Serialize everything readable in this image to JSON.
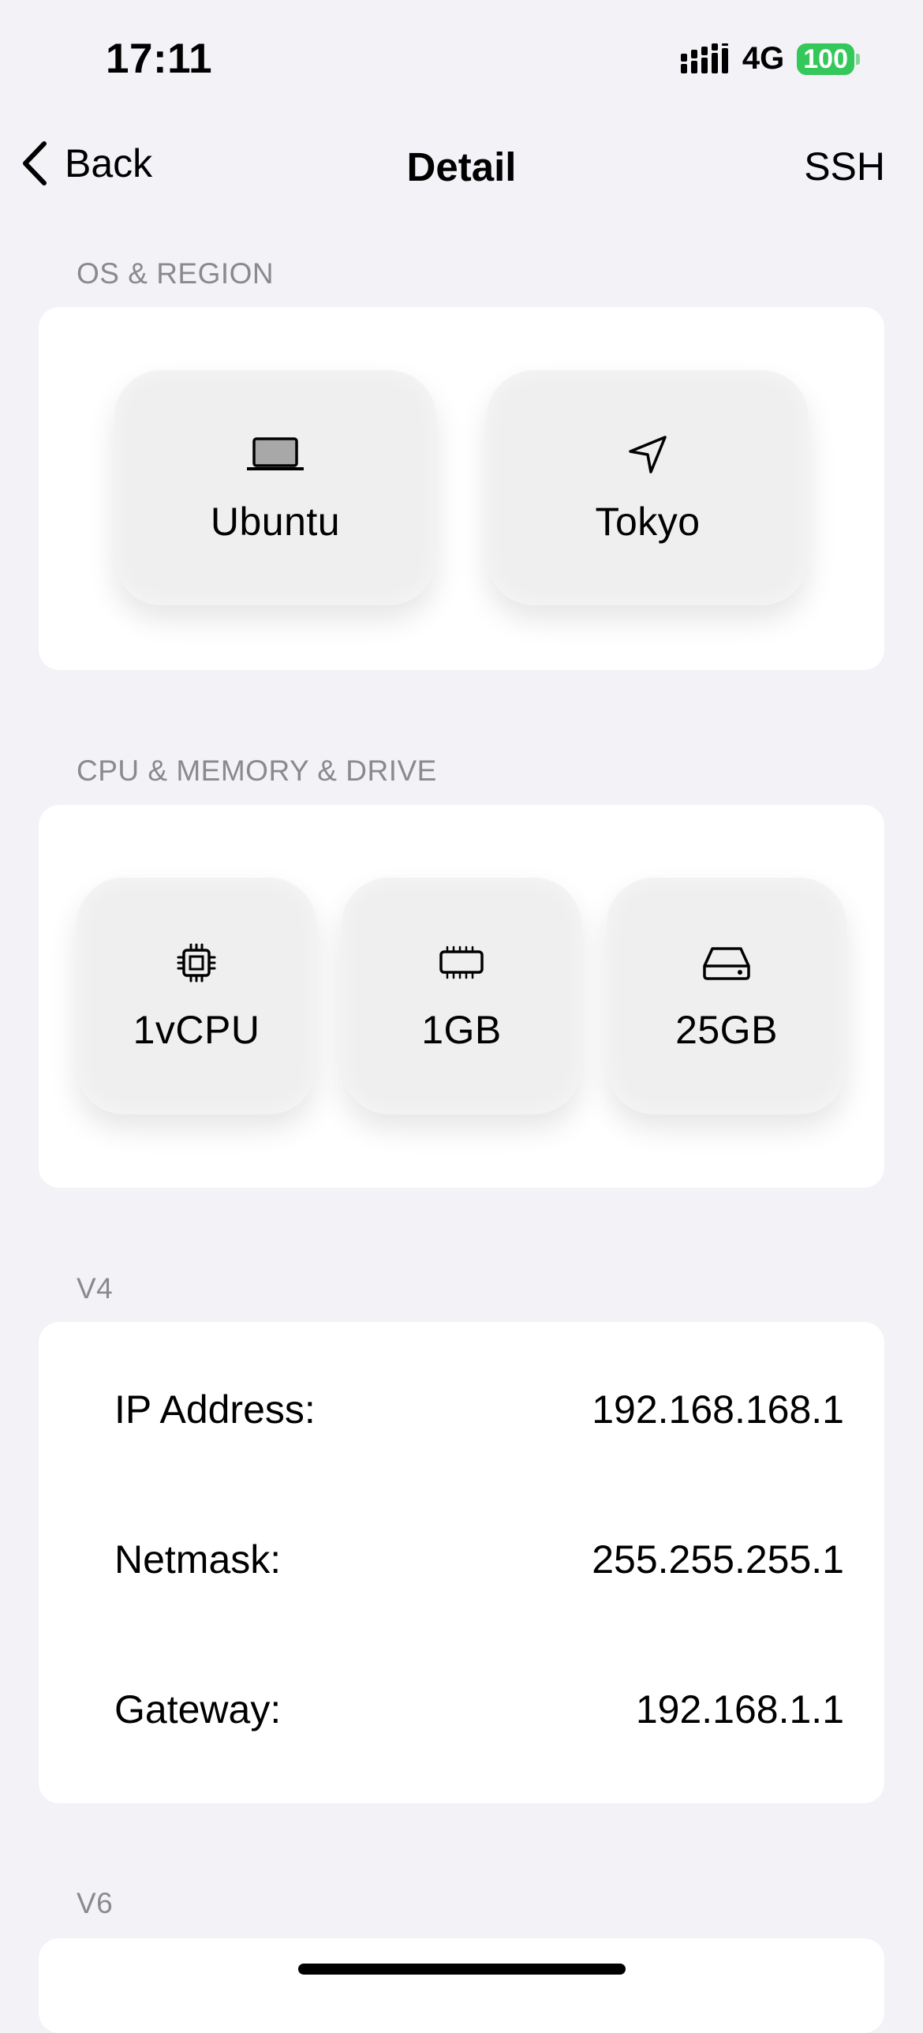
{
  "status_bar": {
    "time": "17:11",
    "network": "4G",
    "battery": "100",
    "signal_icon": "signal-bars-icon",
    "battery_color": "#34c759"
  },
  "nav": {
    "back_label": "Back",
    "title": "Detail",
    "action_label": "SSH",
    "back_icon": "chevron-left-icon"
  },
  "sections": {
    "os_region": {
      "header": "OS & REGION",
      "tiles": [
        {
          "label": "Ubuntu",
          "icon": "laptop-icon"
        },
        {
          "label": "Tokyo",
          "icon": "location-arrow-icon"
        }
      ]
    },
    "cpu_memory_drive": {
      "header": "CPU & MEMORY & DRIVE",
      "tiles": [
        {
          "label": "1vCPU",
          "icon": "cpu-chip-icon"
        },
        {
          "label": "1GB",
          "icon": "memory-icon"
        },
        {
          "label": "25GB",
          "icon": "hard-drive-icon"
        }
      ]
    },
    "v4": {
      "header": "V4",
      "rows": [
        {
          "key": "IP Address:",
          "value": "192.168.168.1"
        },
        {
          "key": "Netmask:",
          "value": "255.255.255.1"
        },
        {
          "key": "Gateway:",
          "value": "192.168.1.1"
        }
      ]
    },
    "v6": {
      "header": "V6"
    }
  }
}
